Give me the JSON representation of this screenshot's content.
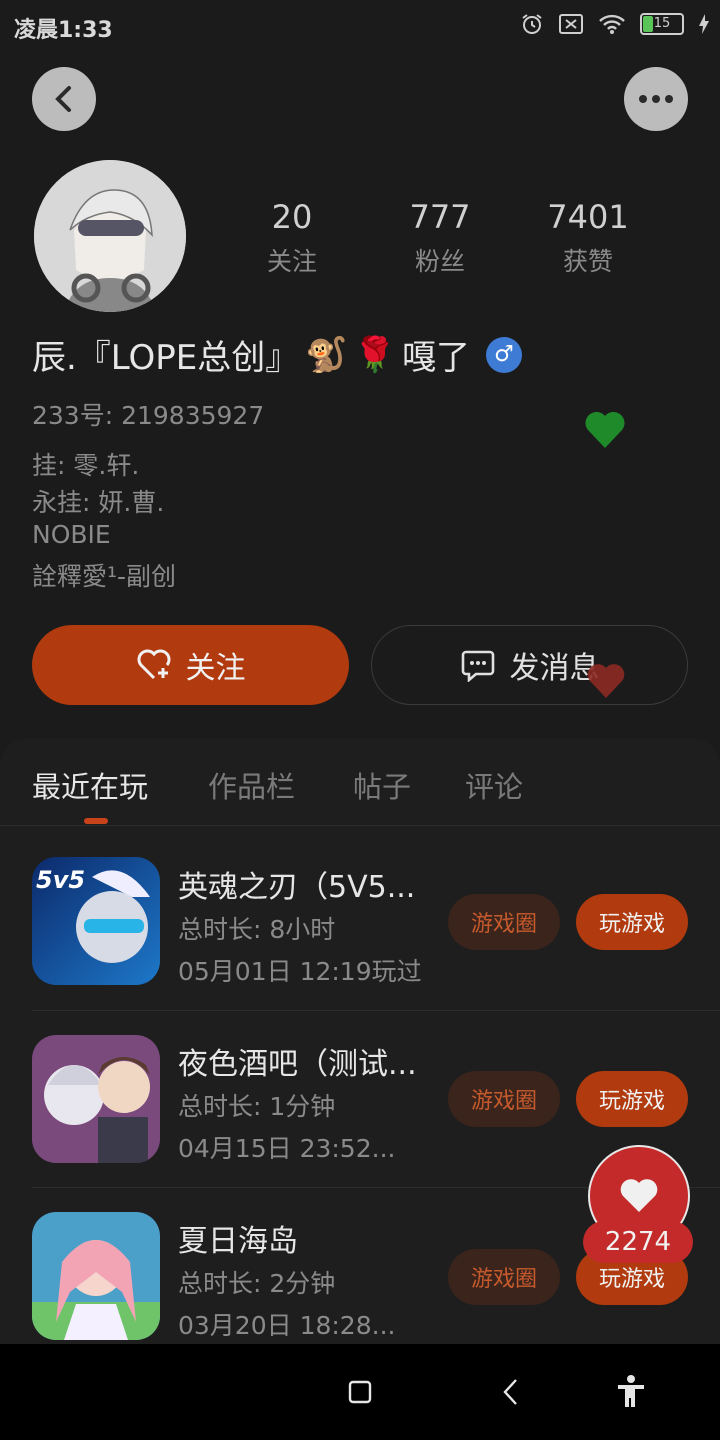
{
  "status_bar": {
    "time": "凌晨1:33",
    "battery": "15"
  },
  "profile": {
    "name": "辰.『LOPE总创』",
    "name_suffix": "嘎了",
    "emoji_1": "🐒",
    "emoji_2": "🌹",
    "gender_symbol": "♂",
    "uid": "233号: 219835927",
    "bio": [
      "挂: 零.轩.",
      "永挂: 妍.曹.",
      "NOBIE",
      "詮釋愛¹-副创"
    ],
    "stats": [
      {
        "value": "20",
        "label": "关注"
      },
      {
        "value": "777",
        "label": "粉丝"
      },
      {
        "value": "7401",
        "label": "获赞"
      }
    ]
  },
  "actions": {
    "follow": "关注",
    "message": "发消息"
  },
  "tabs": [
    "最近在玩",
    "作品栏",
    "帖子",
    "评论"
  ],
  "games": [
    {
      "title": "英魂之刃（5V5...",
      "duration": "总时长: 8小时",
      "last_played": "05月01日 12:19玩过",
      "circle": "游戏圈",
      "play": "玩游戏",
      "icon_text": "5v5"
    },
    {
      "title": "夜色酒吧（测试...",
      "duration": "总时长: 1分钟",
      "last_played": "04月15日 23:52...",
      "circle": "游戏圈",
      "play": "玩游戏"
    },
    {
      "title": "夏日海岛",
      "duration": "总时长: 2分钟",
      "last_played": "03月20日 18:28...",
      "circle": "游戏圈",
      "play": "玩游戏"
    }
  ],
  "like_count": "2274",
  "colors": {
    "accent": "#b13a0f",
    "like": "#c42a2a",
    "heart_green": "#1f8a2a"
  }
}
